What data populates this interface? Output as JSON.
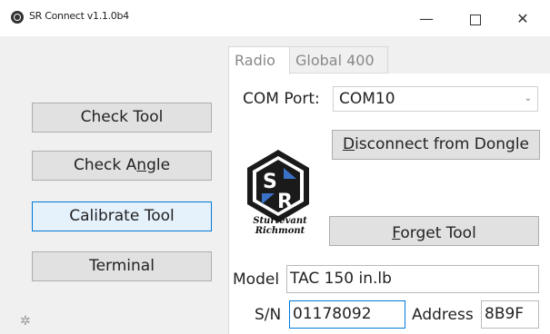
{
  "window": {
    "title": "SR Connect v1.1.0b4",
    "minimize_glyph": "—",
    "close_glyph": "✕"
  },
  "sidebar": {
    "check_tool": "Check Tool",
    "check_angle_pre": "Check A",
    "check_angle_u": "n",
    "check_angle_post": "gle",
    "calibrate_tool": "Calibrate Tool",
    "terminal": "Terminal",
    "settings_icon": "gear-icon"
  },
  "tabs": [
    {
      "label": "Radio"
    },
    {
      "label": "Global 400"
    }
  ],
  "radio": {
    "com_port_label": "COM Port:",
    "com_port_value": "COM10",
    "disconnect_u": "D",
    "disconnect_rest": "isconnect from Dongle",
    "forget_u": "F",
    "forget_rest": "orget Tool",
    "logo_line1": "Sturtevant",
    "logo_line2": "Richmont",
    "model_label": "Model",
    "model_value": "TAC 150 in.lb",
    "sn_label": "S/N",
    "sn_value": "01178092",
    "address_label": "Address",
    "address_value": "8B9F"
  }
}
